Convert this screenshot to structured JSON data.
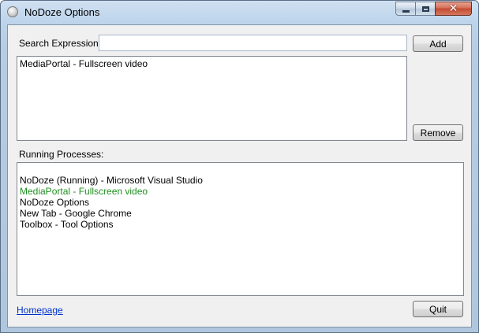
{
  "window": {
    "title": "NoDoze Options",
    "close_glyph": "✕"
  },
  "search": {
    "label": "Search Expression:",
    "value": "",
    "placeholder": ""
  },
  "expressions": {
    "items": [
      {
        "label": "MediaPortal - Fullscreen video"
      }
    ]
  },
  "buttons": {
    "add": "Add",
    "remove": "Remove",
    "quit": "Quit"
  },
  "processes": {
    "label": "Running Processes:",
    "items": [
      {
        "label": "NoDoze (Running) - Microsoft Visual Studio"
      },
      {
        "label": "MediaPortal - Fullscreen video",
        "highlighted": true
      },
      {
        "label": "NoDoze Options"
      },
      {
        "label": "New Tab - Google Chrome"
      },
      {
        "label": "Toolbox - Tool Options"
      }
    ]
  },
  "footer": {
    "homepage_link": "Homepage"
  },
  "colors": {
    "matched_process": "#1f8f1f",
    "link": "#0033cc"
  }
}
